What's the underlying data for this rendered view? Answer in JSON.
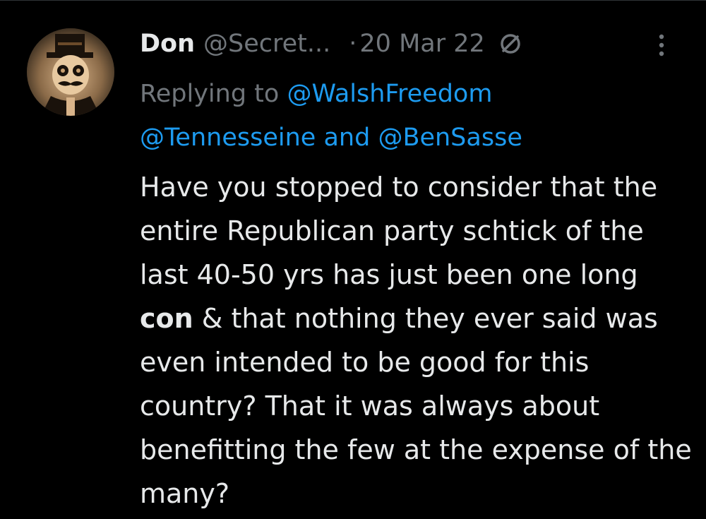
{
  "tweet": {
    "author_name": "Don",
    "author_handle": "@Secret...",
    "separator": "·",
    "date": "20 Mar 22",
    "reply_prefix": "Replying to",
    "mentions": [
      "@WalshFreedom",
      "@Tennesseine",
      "@BenSasse"
    ],
    "mention_joiner": "and",
    "text_part1": "Have you stopped to consider that the entire Republican party schtick of the last 40-50 yrs has just been one long",
    "text_bold": "con",
    "text_part2": "& that nothing they ever said was even intended to be good for this country? That it was always about benefitting the few at the expense of the many?"
  },
  "icons": {
    "avatar": "avatar-image",
    "blocked": "blocked-circle-icon",
    "more": "more-vertical-icon"
  },
  "colors": {
    "background": "#000000",
    "text_primary": "#e7e9ea",
    "text_secondary": "#71767b",
    "accent": "#1d9bf0"
  }
}
